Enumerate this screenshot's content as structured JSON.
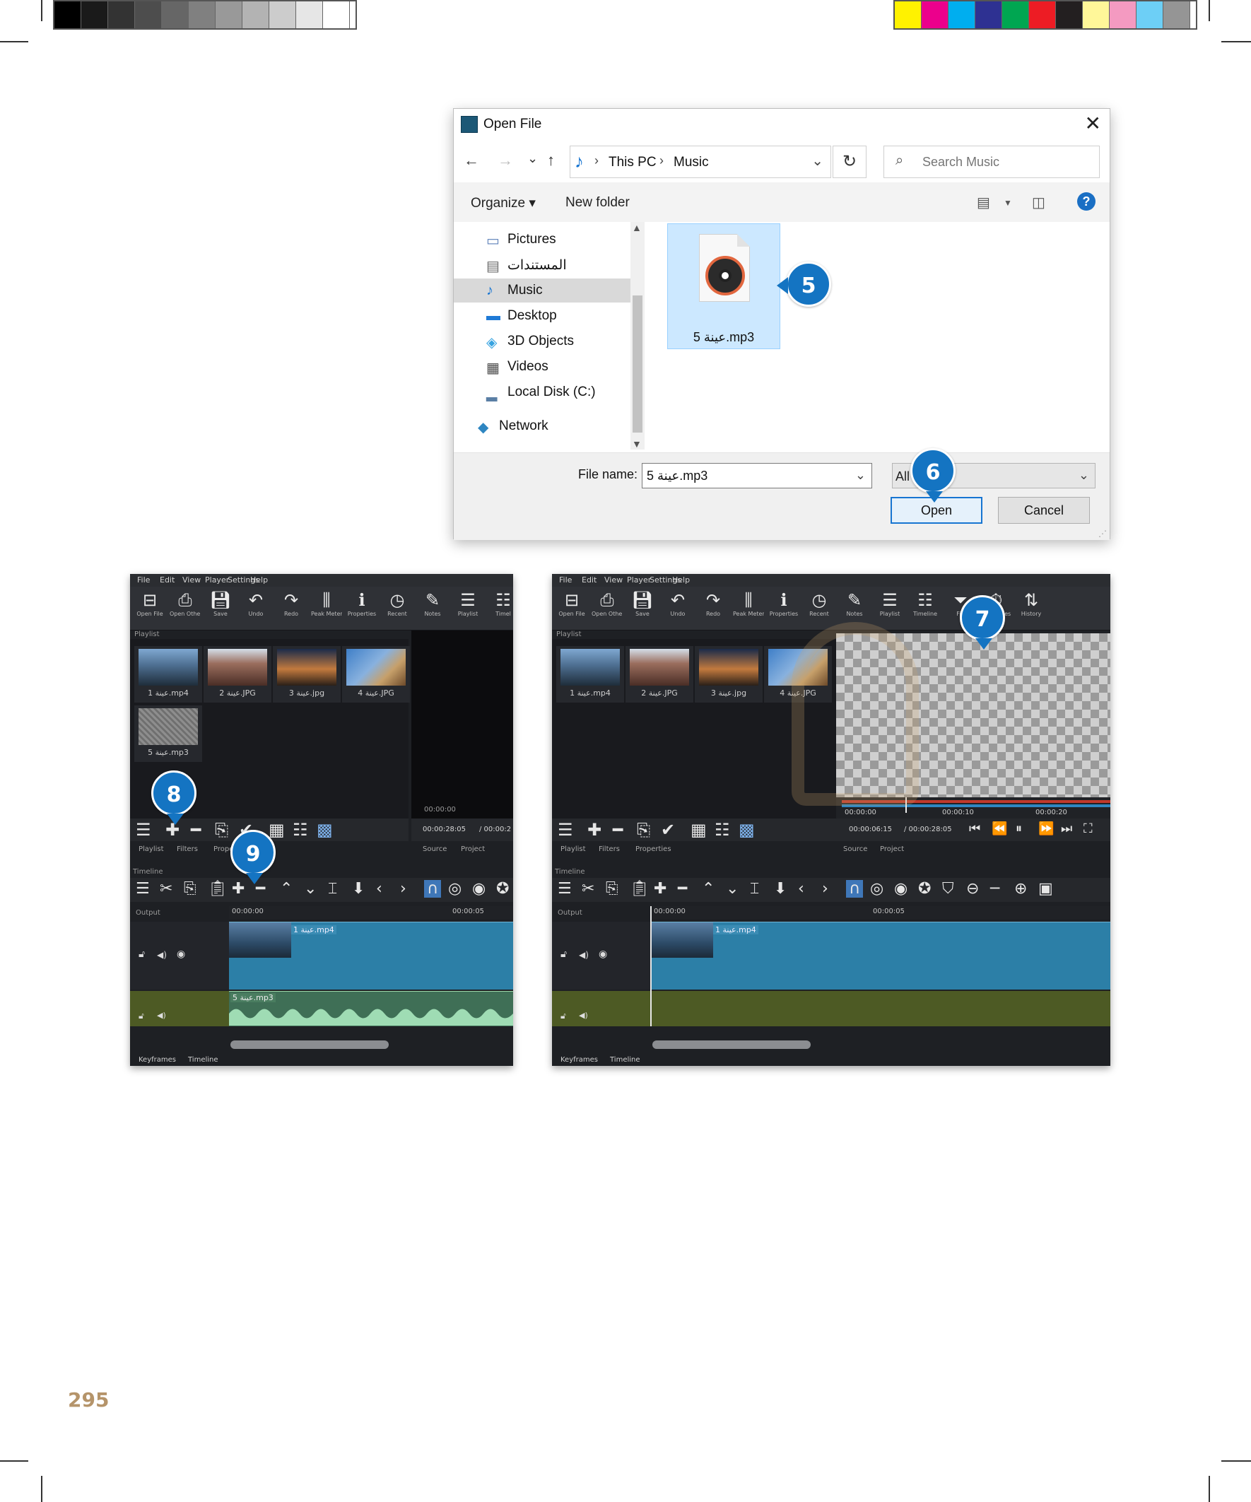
{
  "print_marks": {
    "gray_swatches": [
      "#000000",
      "#1a1a1a",
      "#333333",
      "#4d4d4d",
      "#666666",
      "#808080",
      "#999999",
      "#b3b3b3",
      "#cccccc",
      "#e6e6e6",
      "#ffffff"
    ],
    "color_swatches": [
      "#fff200",
      "#ec008c",
      "#00aeef",
      "#2e3192",
      "#00a651",
      "#ed1c24",
      "#231f20",
      "#fff799",
      "#f49ac1",
      "#6dcff6",
      "#959595"
    ]
  },
  "dialog": {
    "title": "Open File",
    "nav": {
      "back": "←",
      "forward": "→",
      "recent": "⌄",
      "up": "↑"
    },
    "path": [
      "This PC",
      "Music"
    ],
    "search_placeholder": "Search Music",
    "commands": {
      "organize": "Organize ▾",
      "new_folder": "New folder"
    },
    "nav_items": [
      {
        "label": "Pictures",
        "icon": "pictures-folder-icon"
      },
      {
        "label": "المستندات",
        "icon": "documents-folder-icon"
      },
      {
        "label": "Music",
        "icon": "music-note-icon",
        "selected": true
      },
      {
        "label": "Desktop",
        "icon": "desktop-folder-icon"
      },
      {
        "label": "3D Objects",
        "icon": "cube-icon"
      },
      {
        "label": "Videos",
        "icon": "film-icon"
      },
      {
        "label": "Local Disk (C:)",
        "icon": "drive-icon"
      },
      {
        "label": "Network",
        "icon": "network-icon"
      }
    ],
    "file": {
      "name": "5 عينة.mp3",
      "icon": "vinyl-music-file-icon"
    },
    "filename_label": "File name:",
    "filename_value": "5 عينة.mp3",
    "filter_value": "All F",
    "open_label": "Open",
    "cancel_label": "Cancel"
  },
  "shotcut": {
    "menu": [
      "File",
      "Edit",
      "View",
      "Player",
      "Settings",
      "Help"
    ],
    "toolbar_left": [
      {
        "label": "Open File",
        "icon": "open-file-icon"
      },
      {
        "label": "Open Other",
        "icon": "open-other-icon"
      },
      {
        "label": "Save",
        "icon": "save-icon"
      },
      {
        "label": "Undo",
        "icon": "undo-icon"
      },
      {
        "label": "Redo",
        "icon": "redo-icon"
      },
      {
        "label": "Peak Meter",
        "icon": "peak-meter-icon"
      },
      {
        "label": "Properties",
        "icon": "properties-icon"
      },
      {
        "label": "Recent",
        "icon": "recent-icon"
      },
      {
        "label": "Notes",
        "icon": "notes-icon"
      },
      {
        "label": "Playlist",
        "icon": "playlist-icon"
      },
      {
        "label": "Timel",
        "icon": "timeline-icon"
      }
    ],
    "toolbar_right": [
      {
        "label": "Open File",
        "icon": "open-file-icon"
      },
      {
        "label": "Open Other",
        "icon": "open-other-icon"
      },
      {
        "label": "Save",
        "icon": "save-icon"
      },
      {
        "label": "Undo",
        "icon": "undo-icon"
      },
      {
        "label": "Redo",
        "icon": "redo-icon"
      },
      {
        "label": "Peak Meter",
        "icon": "peak-meter-icon"
      },
      {
        "label": "Properties",
        "icon": "properties-icon"
      },
      {
        "label": "Recent",
        "icon": "recent-icon"
      },
      {
        "label": "Notes",
        "icon": "notes-icon"
      },
      {
        "label": "Playlist",
        "icon": "playlist-icon"
      },
      {
        "label": "Timeline",
        "icon": "timeline-icon"
      },
      {
        "label": "Filt",
        "icon": "filters-icon"
      },
      {
        "label": "Keyframes",
        "icon": "keyframes-icon"
      },
      {
        "label": "History",
        "icon": "history-icon"
      }
    ],
    "playlist_label": "Playlist",
    "clips_left": [
      "1 عينة.mp4",
      "2 عينة.JPG",
      "3 عينة.jpg",
      "4 عينة.JPG",
      "5 عينة.mp3"
    ],
    "clips_right": [
      "1 عينة.mp4",
      "2 عينة.JPG",
      "3 عينة.jpg",
      "4 عينة.JPG"
    ],
    "tabs_left": [
      "Playlist",
      "Filters",
      "Prope"
    ],
    "tabs_right": [
      "Playlist",
      "Filters",
      "Properties"
    ],
    "player_tabs": [
      "Source",
      "Project"
    ],
    "timecode_left": "00:00:00",
    "duration_left": "00:00:28:05",
    "total_left": "/ 00:00:2",
    "timecode_right": "00:00:06:15",
    "total_right": "/ 00:00:28:05",
    "ruler_right": [
      "00:00:00",
      "00:00:10",
      "00:00:20"
    ],
    "timeline_label": "Timeline",
    "output_label": "Output",
    "ruler_ticks": [
      "00:00:00",
      "00:00:05"
    ],
    "video_clip": "عينة 1.mp4",
    "audio_clip": "عينة 5.mp3",
    "bottom_tabs": [
      "Keyframes",
      "Timeline"
    ]
  },
  "callouts": [
    "5",
    "6",
    "7",
    "8",
    "9"
  ],
  "page_number": "295"
}
